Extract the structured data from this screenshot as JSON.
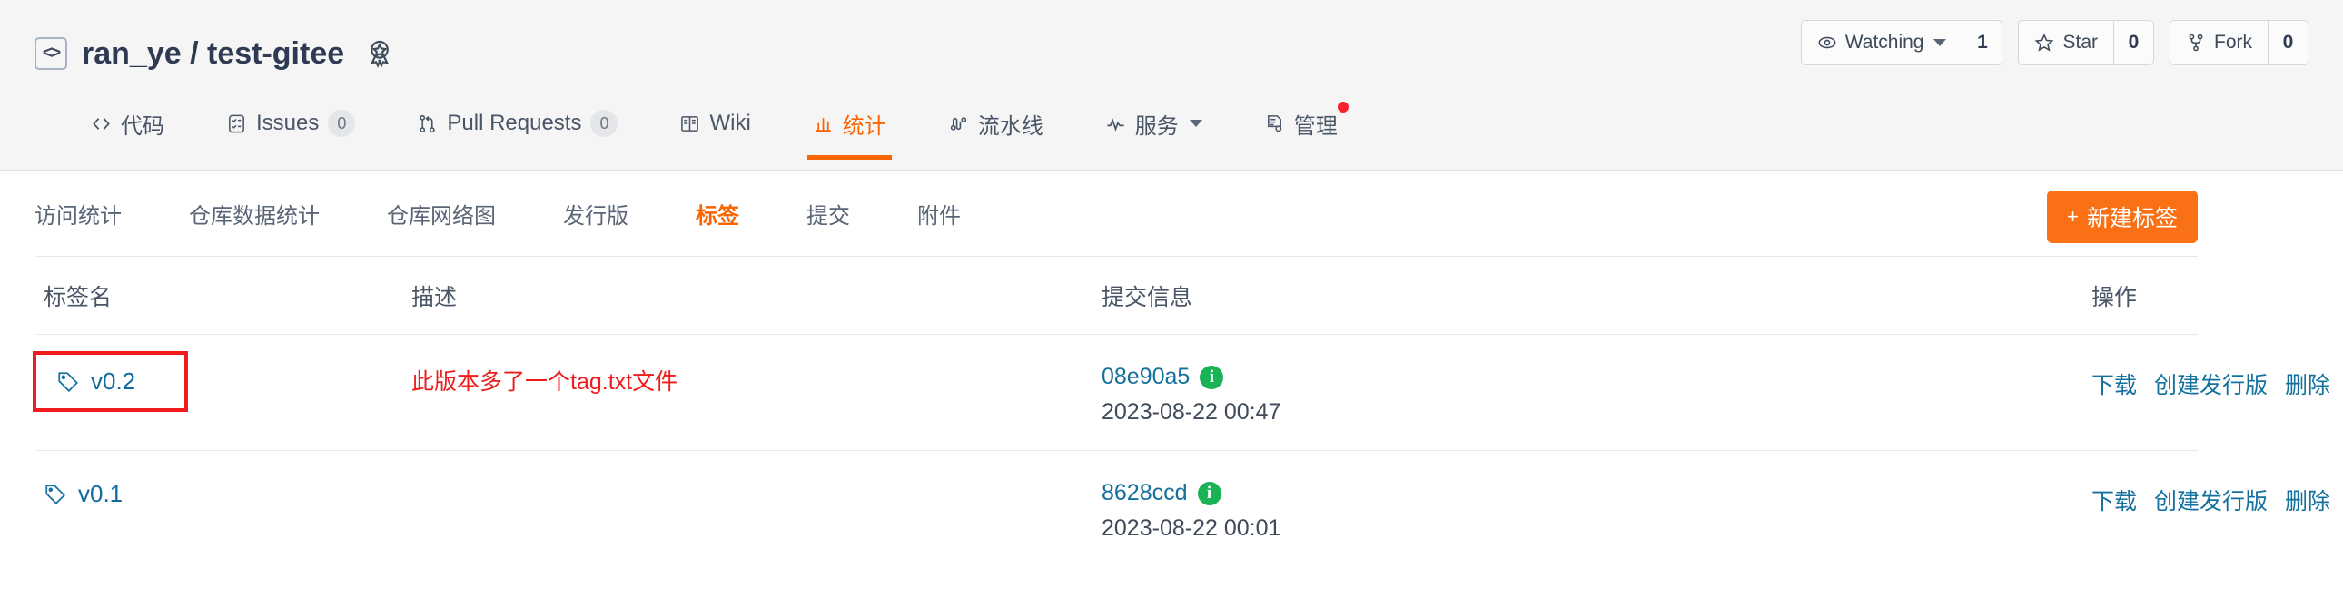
{
  "header": {
    "code_icon": "code-icon",
    "owner": "ran_ye",
    "separator": "/",
    "repo": "test-gitee",
    "badge_icon": "award-ribbon-icon",
    "actions": [
      {
        "label": "Watching",
        "count": "1",
        "icon": "eye-icon",
        "has_caret": true
      },
      {
        "label": "Star",
        "count": "0",
        "icon": "star-icon",
        "has_caret": false
      },
      {
        "label": "Fork",
        "count": "0",
        "icon": "fork-icon",
        "has_caret": false
      }
    ]
  },
  "nav_tabs": [
    {
      "label": "代码",
      "icon": "code-brackets-icon",
      "count": null,
      "active": false,
      "dot": false
    },
    {
      "label": "Issues",
      "icon": "issues-icon",
      "count": "0",
      "active": false,
      "dot": false
    },
    {
      "label": "Pull Requests",
      "icon": "pull-request-icon",
      "count": "0",
      "active": false,
      "dot": false
    },
    {
      "label": "Wiki",
      "icon": "book-icon",
      "count": null,
      "active": false,
      "dot": false
    },
    {
      "label": "统计",
      "icon": "chart-bar-icon",
      "count": null,
      "active": true,
      "dot": false
    },
    {
      "label": "流水线",
      "icon": "pipeline-icon",
      "count": null,
      "active": false,
      "dot": false
    },
    {
      "label": "服务",
      "icon": "activity-icon",
      "count": null,
      "active": false,
      "dot": false,
      "caret": true
    },
    {
      "label": "管理",
      "icon": "document-gear-icon",
      "count": null,
      "active": false,
      "dot": true
    }
  ],
  "subnav": {
    "items": [
      {
        "label": "访问统计",
        "active": false
      },
      {
        "label": "仓库数据统计",
        "active": false
      },
      {
        "label": "仓库网络图",
        "active": false
      },
      {
        "label": "发行版",
        "active": false
      },
      {
        "label": "标签",
        "active": true
      },
      {
        "label": "提交",
        "active": false
      },
      {
        "label": "附件",
        "active": false
      }
    ],
    "new_tag_button": {
      "plus": "+",
      "label": "新建标签"
    }
  },
  "table": {
    "headers": {
      "name": "标签名",
      "description": "描述",
      "commit": "提交信息",
      "operations": "操作"
    },
    "rows": [
      {
        "tag": "v0.2",
        "tag_icon": "tag-icon",
        "highlighted": true,
        "description": "此版本多了一个tag.txt文件",
        "commit_hash": "08e90a5",
        "commit_info_icon": "info-icon",
        "commit_date": "2023-08-22 00:47",
        "operations": [
          "下载",
          "创建发行版",
          "删除"
        ]
      },
      {
        "tag": "v0.1",
        "tag_icon": "tag-icon",
        "highlighted": false,
        "description": "",
        "commit_hash": "8628ccd",
        "commit_info_icon": "info-icon",
        "commit_date": "2023-08-22 00:01",
        "operations": [
          "下载",
          "创建发行版",
          "删除"
        ]
      }
    ]
  },
  "colors": {
    "accent_orange": "#fa6400",
    "button_orange": "#fa7014",
    "link_blue": "#14719e",
    "annotation_red": "#f01b1b",
    "info_green": "#19b355",
    "header_bg": "#f5f5f5"
  }
}
